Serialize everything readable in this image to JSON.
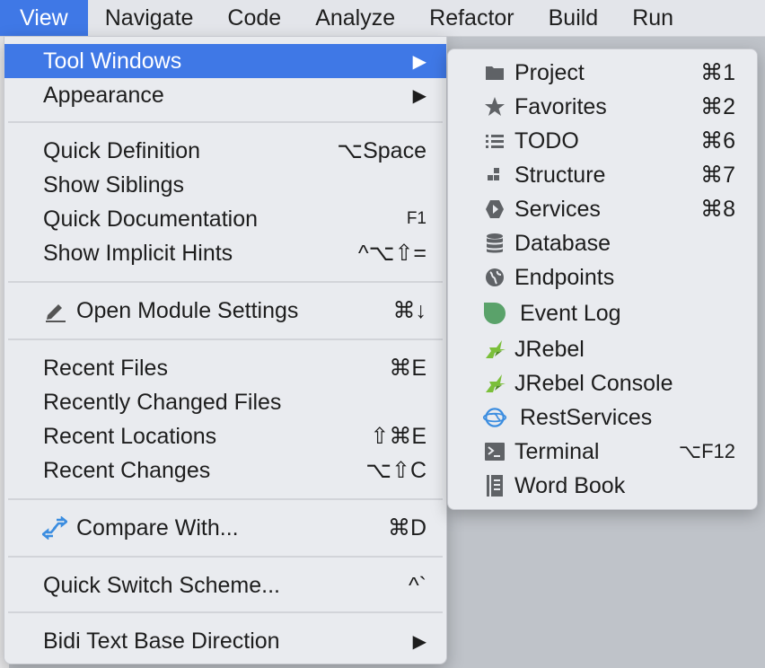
{
  "menubar": {
    "items": [
      {
        "label": "View"
      },
      {
        "label": "Navigate"
      },
      {
        "label": "Code"
      },
      {
        "label": "Analyze"
      },
      {
        "label": "Refactor"
      },
      {
        "label": "Build"
      },
      {
        "label": "Run"
      }
    ]
  },
  "view_menu": {
    "tool_windows": {
      "label": "Tool Windows",
      "arrow": "▶"
    },
    "appearance": {
      "label": "Appearance",
      "arrow": "▶"
    },
    "quick_definition": {
      "label": "Quick Definition",
      "shortcut": "⌥Space"
    },
    "show_siblings": {
      "label": "Show Siblings"
    },
    "quick_documentation": {
      "label": "Quick Documentation",
      "shortcut": "F1"
    },
    "show_implicit_hints": {
      "label": "Show Implicit Hints",
      "shortcut": "^⌥⇧="
    },
    "open_module_settings": {
      "label": "Open Module Settings",
      "shortcut": "⌘↓"
    },
    "recent_files": {
      "label": "Recent Files",
      "shortcut": "⌘E"
    },
    "recently_changed_files": {
      "label": "Recently Changed Files"
    },
    "recent_locations": {
      "label": "Recent Locations",
      "shortcut": "⇧⌘E"
    },
    "recent_changes": {
      "label": "Recent Changes",
      "shortcut": "⌥⇧C"
    },
    "compare_with": {
      "label": "Compare With...",
      "shortcut": "⌘D"
    },
    "quick_switch_scheme": {
      "label": "Quick Switch Scheme...",
      "shortcut": "^`"
    },
    "bidi_text": {
      "label": "Bidi Text Base Direction",
      "arrow": "▶"
    }
  },
  "tool_windows_menu": {
    "items": [
      {
        "label": "Project",
        "shortcut": "⌘1",
        "icon": "folder-icon"
      },
      {
        "label": "Favorites",
        "shortcut": "⌘2",
        "icon": "star-icon"
      },
      {
        "label": "TODO",
        "shortcut": "⌘6",
        "icon": "list-icon"
      },
      {
        "label": "Structure",
        "shortcut": "⌘7",
        "icon": "structure-icon"
      },
      {
        "label": "Services",
        "shortcut": "⌘8",
        "icon": "play-icon"
      },
      {
        "label": "Database",
        "shortcut": "",
        "icon": "database-icon"
      },
      {
        "label": "Endpoints",
        "shortcut": "",
        "icon": "globe-icon"
      },
      {
        "label": "Event Log",
        "shortcut": "",
        "icon": "event-log-icon"
      },
      {
        "label": "JRebel",
        "shortcut": "",
        "icon": "jrebel-icon"
      },
      {
        "label": "JRebel Console",
        "shortcut": "",
        "icon": "jrebel-icon"
      },
      {
        "label": "RestServices",
        "shortcut": "",
        "icon": "rest-globe-icon"
      },
      {
        "label": "Terminal",
        "shortcut": "⌥F12",
        "icon": "terminal-icon"
      },
      {
        "label": "Word Book",
        "shortcut": "",
        "icon": "book-icon"
      }
    ]
  },
  "colors": {
    "accent": "#3f78e6",
    "menu_bg": "#e9ebef",
    "event_log_green": "#5aa26a",
    "jrebel_green": "#7bbf3a",
    "rest_blue": "#3b8de0"
  }
}
